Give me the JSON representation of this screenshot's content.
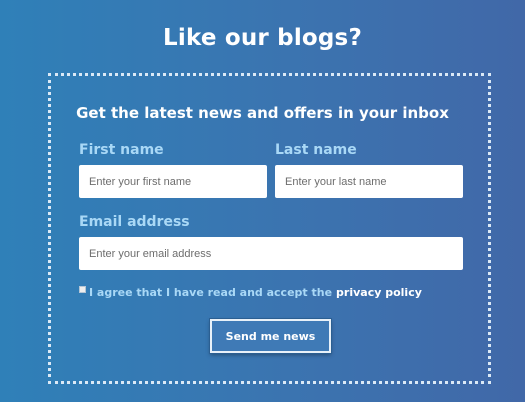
{
  "page": {
    "title": "Like our blogs?"
  },
  "signup": {
    "heading": "Get the latest news and offers in your inbox",
    "first_name": {
      "label": "First name",
      "value": "",
      "placeholder": "Enter your first name"
    },
    "last_name": {
      "label": "Last name",
      "value": "",
      "placeholder": "Enter your last name"
    },
    "email": {
      "label": "Email address",
      "value": "",
      "placeholder": "Enter your email address"
    },
    "consent": {
      "checked": false,
      "text": "I agree that I have read and accept the",
      "link_text": "privacy policy"
    },
    "submit_label": "Send me news"
  },
  "colors": {
    "background_left": "#2f80b8",
    "background_right": "#4168a8",
    "label": "#a9d8f6",
    "text": "#ffffff"
  }
}
